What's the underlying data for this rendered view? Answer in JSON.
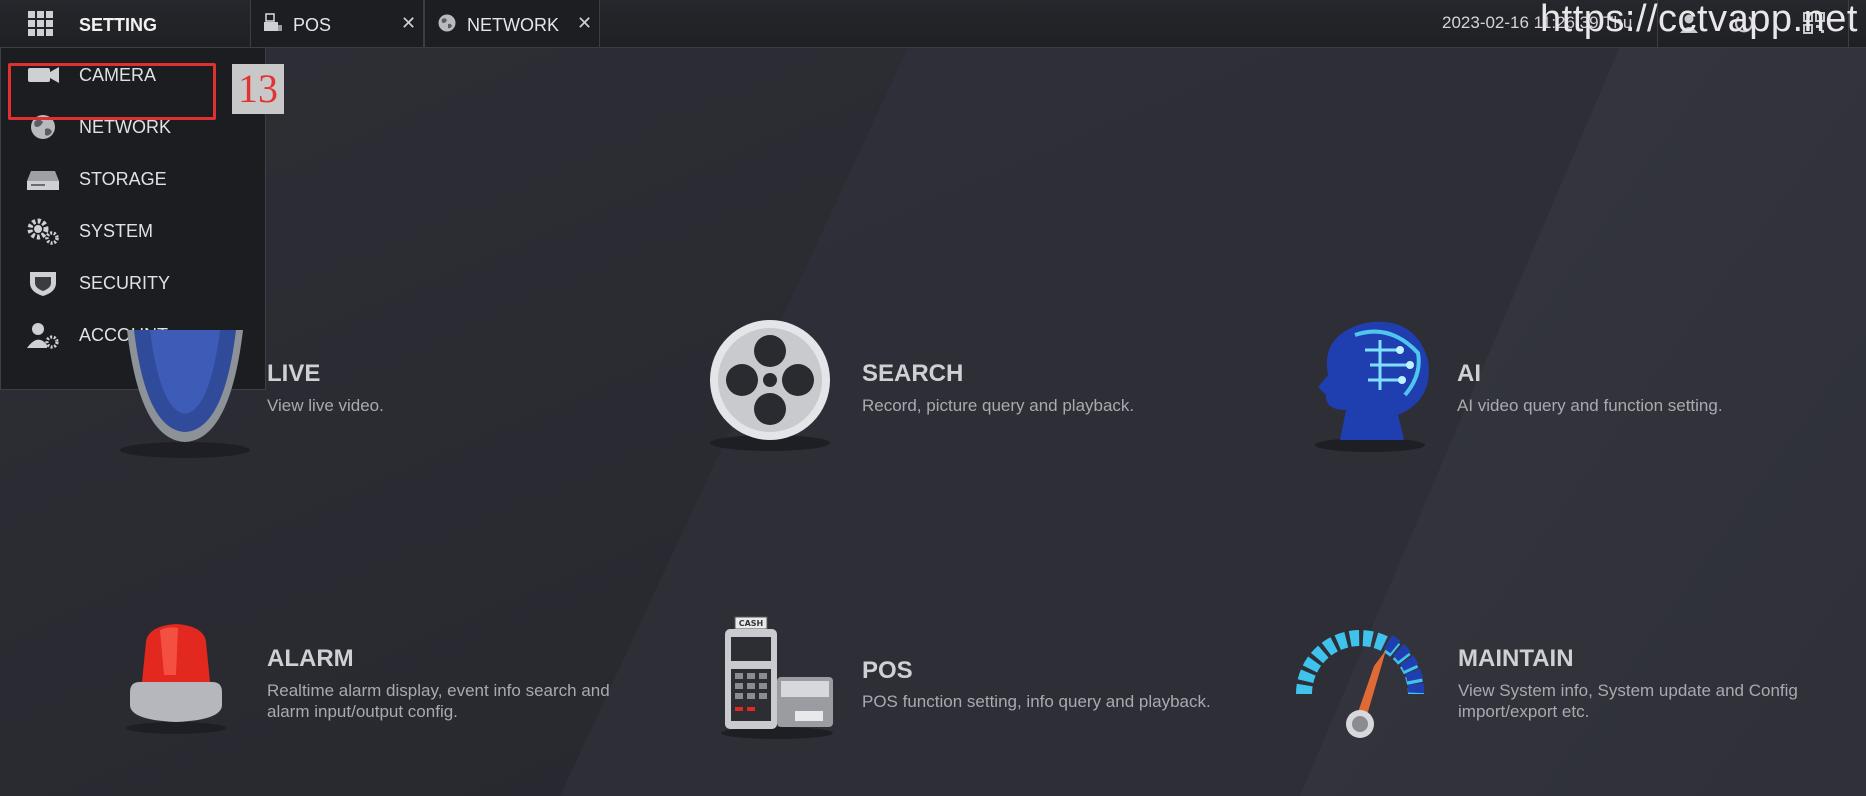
{
  "topbar": {
    "title": "SETTING",
    "tabs": [
      {
        "label": "POS",
        "icon": "pos-icon"
      },
      {
        "label": "NETWORK",
        "icon": "globe-icon"
      }
    ],
    "datetime": "2023-02-16 11:26:39 Thu",
    "watermark": "https://cctvapp.net"
  },
  "menu": {
    "items": [
      {
        "label": "CAMERA",
        "icon": "camera-icon"
      },
      {
        "label": "NETWORK",
        "icon": "globe-icon"
      },
      {
        "label": "STORAGE",
        "icon": "hard-disk-icon"
      },
      {
        "label": "SYSTEM",
        "icon": "gears-icon"
      },
      {
        "label": "SECURITY",
        "icon": "shield-icon"
      },
      {
        "label": "ACCOUNT",
        "icon": "user-gear-icon"
      }
    ],
    "annotation_number": "13",
    "highlight_color": "#e03030"
  },
  "tiles": [
    {
      "title": "LIVE",
      "desc": "View live video.",
      "icon": "live-lens-icon"
    },
    {
      "title": "SEARCH",
      "desc": "Record, picture query and playback.",
      "icon": "film-reel-icon"
    },
    {
      "title": "AI",
      "desc": "AI video query and function setting.",
      "icon": "ai-head-icon"
    },
    {
      "title": "ALARM",
      "desc": "Realtime alarm display, event info search and alarm input/output config.",
      "icon": "alarm-siren-icon"
    },
    {
      "title": "POS",
      "desc": "POS function setting, info query and playback.",
      "icon": "cash-register-icon"
    },
    {
      "title": "MAINTAIN",
      "desc": "View System info, System update and Config import/export etc.",
      "icon": "gauge-icon"
    }
  ]
}
